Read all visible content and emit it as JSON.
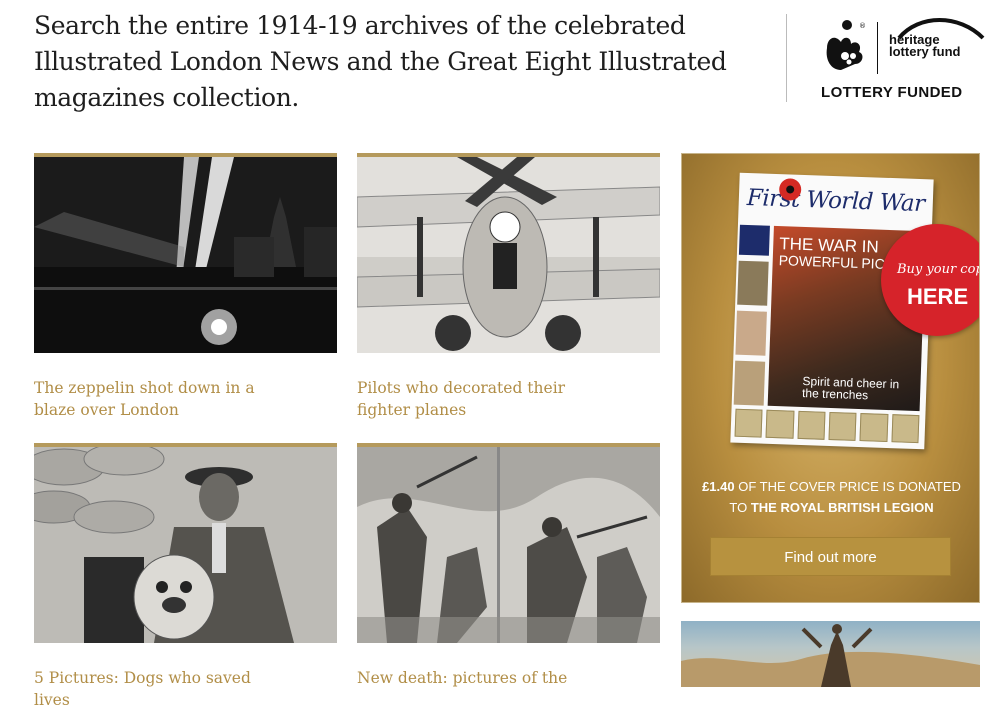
{
  "header": {
    "headline": "Search the entire 1914-19 archives of the celebrated Illustrated London News and the Great Eight Illustrated magazines collection.",
    "lottery": {
      "hlf_line1": "heritage",
      "hlf_line2": "lottery fund",
      "funded_label": "LOTTERY FUNDED"
    }
  },
  "cards": [
    {
      "caption": "The zeppelin shot down in a blaze over London",
      "icon": "searchlights-photo"
    },
    {
      "caption": "Pilots who decorated their fighter planes",
      "icon": "biplane-photo"
    },
    {
      "caption": "5 Pictures: Dogs who saved lives",
      "icon": "soldier-dog-photo"
    },
    {
      "caption": "New death: pictures of the",
      "icon": "battle-illustration"
    }
  ],
  "ad": {
    "magazine_title": "First World War",
    "magazine_headline_1": "THE WAR IN",
    "magazine_headline_2": "POWERFUL PICT",
    "magazine_subline": "Spirit and cheer in the trenches",
    "badge_line1": "Buy your copy",
    "badge_line2": "HERE",
    "donate_amount": "£1.40",
    "donate_text_1": " OF THE COVER PRICE IS DONATED",
    "donate_text_2": "TO ",
    "donate_beneficiary": "THE ROYAL BRITISH LEGION",
    "button_label": "Find out more"
  },
  "colors": {
    "caption_gold": "#b18e47",
    "card_bar": "#b59a5c",
    "ad_button": "#b7923f",
    "badge_red": "#d6232a"
  }
}
